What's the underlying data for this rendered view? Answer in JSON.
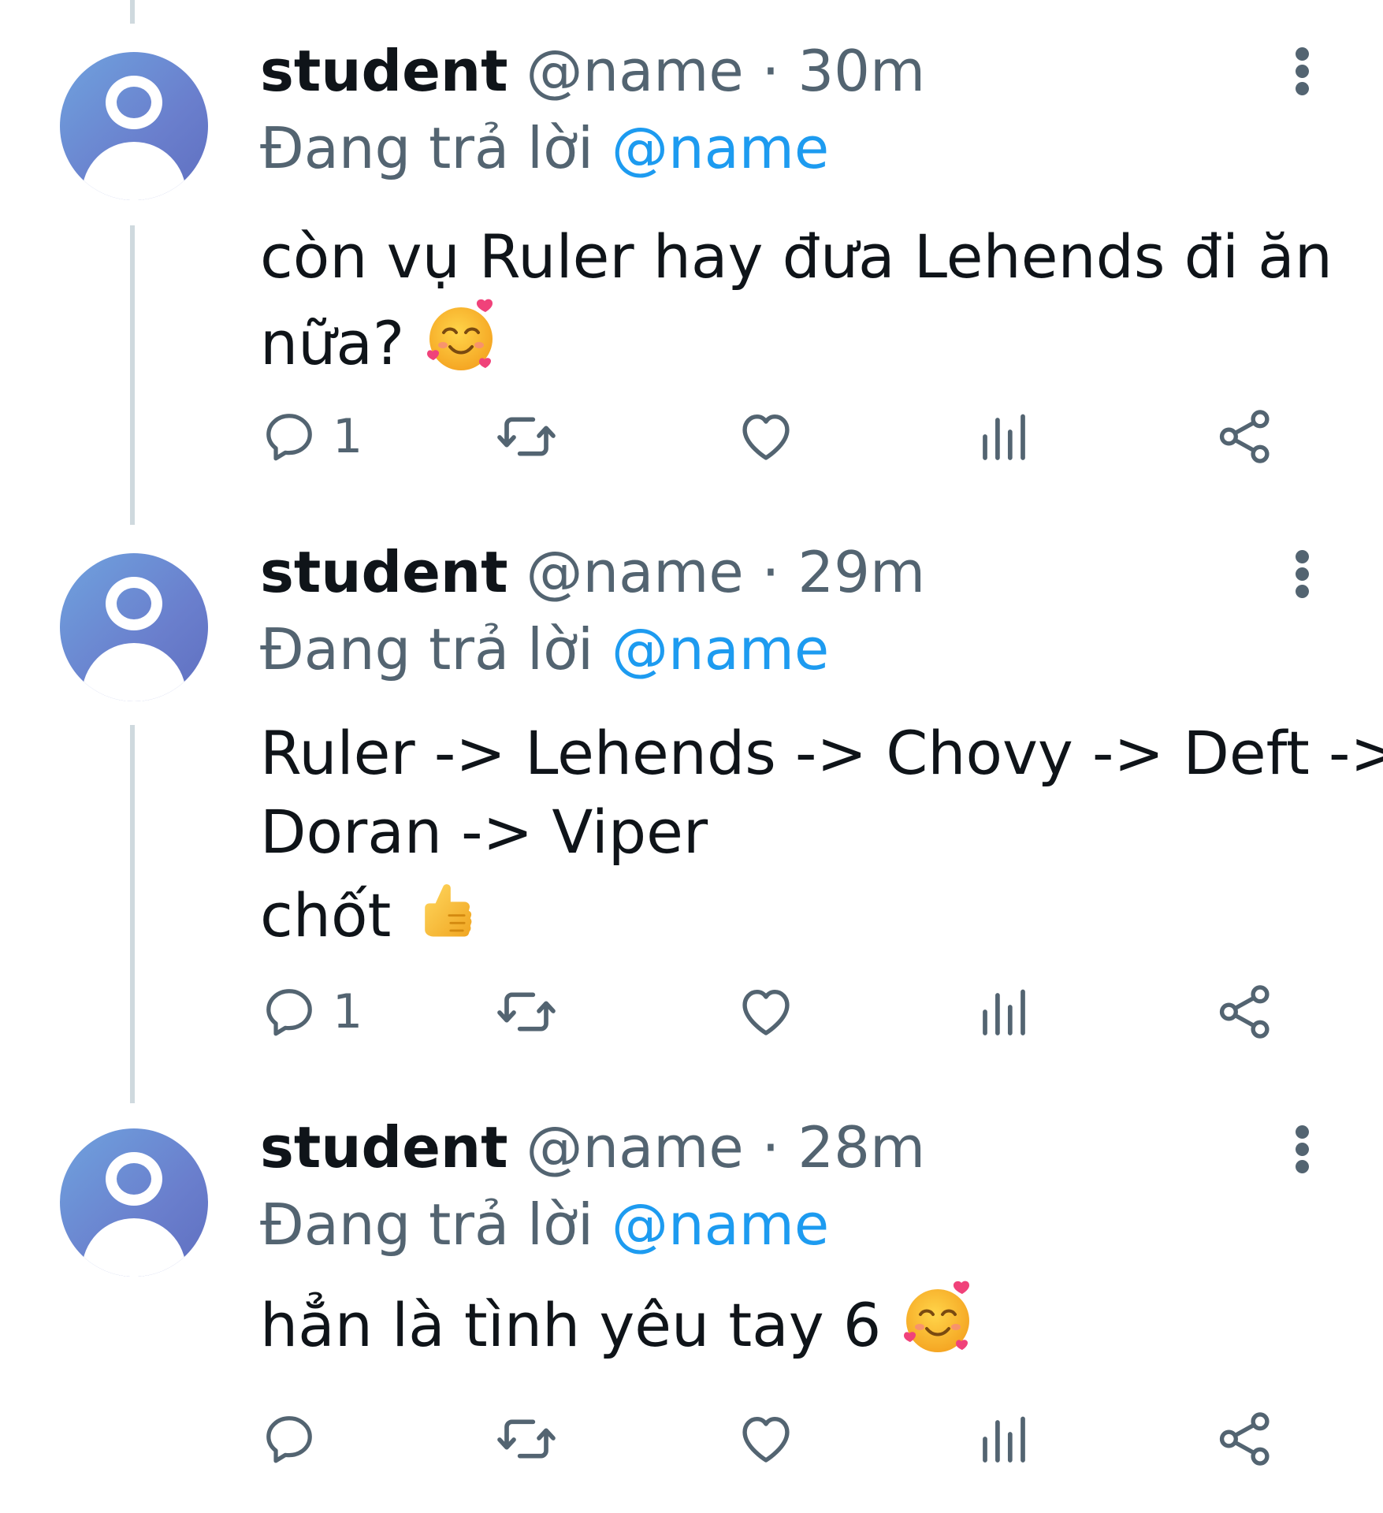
{
  "colors": {
    "mention": "#1d9bf0",
    "secondary": "#536471",
    "text": "#0f1419",
    "thread_line": "#cfd9de"
  },
  "tweets": [
    {
      "display_name": "student",
      "handle": "@name",
      "separator": "·",
      "time": "30m",
      "reply_prefix": "Đang trả lời",
      "reply_to": "@name",
      "lines": [
        "còn vụ Ruler hay đưa Lehends đi ăn",
        "nữa?"
      ],
      "emoji": "smiling-face-with-hearts",
      "reply_count": "1"
    },
    {
      "display_name": "student",
      "handle": "@name",
      "separator": "·",
      "time": "29m",
      "reply_prefix": "Đang trả lời",
      "reply_to": "@name",
      "lines": [
        "Ruler -> Lehends -> Chovy -> Deft ->",
        "Doran -> Viper",
        "chốt"
      ],
      "emoji": "thumbs-up",
      "reply_count": "1"
    },
    {
      "display_name": "student",
      "handle": "@name",
      "separator": "·",
      "time": "28m",
      "reply_prefix": "Đang trả lời",
      "reply_to": "@name",
      "lines": [
        "hẳn là tình yêu tay 6"
      ],
      "emoji": "smiling-face-with-hearts",
      "reply_count": ""
    }
  ],
  "icons": {
    "reply": "reply-icon",
    "retweet": "retweet-icon",
    "like": "like-icon",
    "views": "views-icon",
    "share": "share-icon",
    "more": "more-options-icon"
  }
}
